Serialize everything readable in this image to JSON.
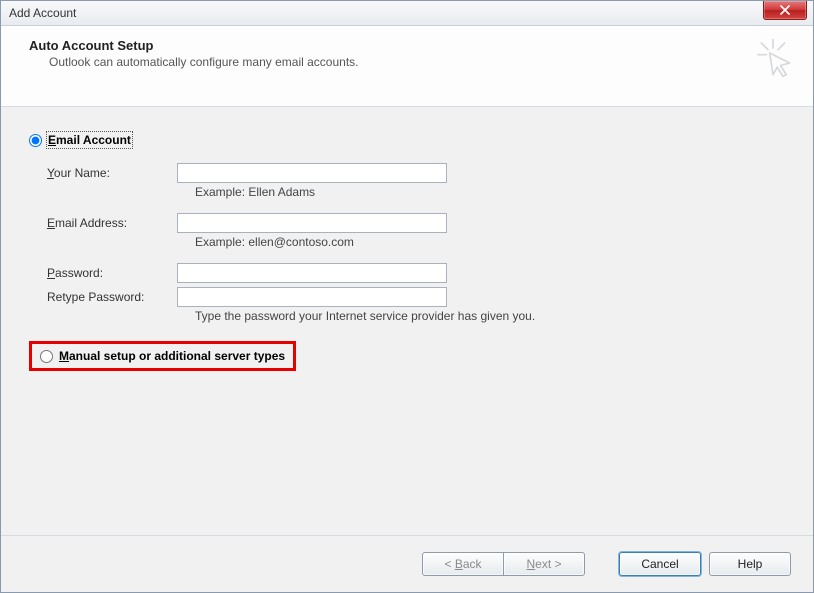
{
  "titlebar": {
    "title": "Add Account"
  },
  "header": {
    "title": "Auto Account Setup",
    "subtitle": "Outlook can automatically configure many email accounts."
  },
  "options": {
    "email_account_label_pre": "E",
    "email_account_label_post": "mail Account",
    "manual_label_pre": "M",
    "manual_label_post": "anual setup or additional server types"
  },
  "fields": {
    "name_label_pre": "Y",
    "name_label_post": "our Name:",
    "name_value": "",
    "name_hint": "Example: Ellen Adams",
    "email_label_pre": "E",
    "email_label_post": "mail Address:",
    "email_value": "",
    "email_hint": "Example: ellen@contoso.com",
    "password_label_pre": "P",
    "password_label_post": "assword:",
    "password_value": "",
    "retype_label": "Retype Password:",
    "retype_value": "",
    "password_hint": "Type the password your Internet service provider has given you."
  },
  "footer": {
    "back_html": "< Back",
    "next_html": "Next >",
    "cancel": "Cancel",
    "help": "Help"
  }
}
